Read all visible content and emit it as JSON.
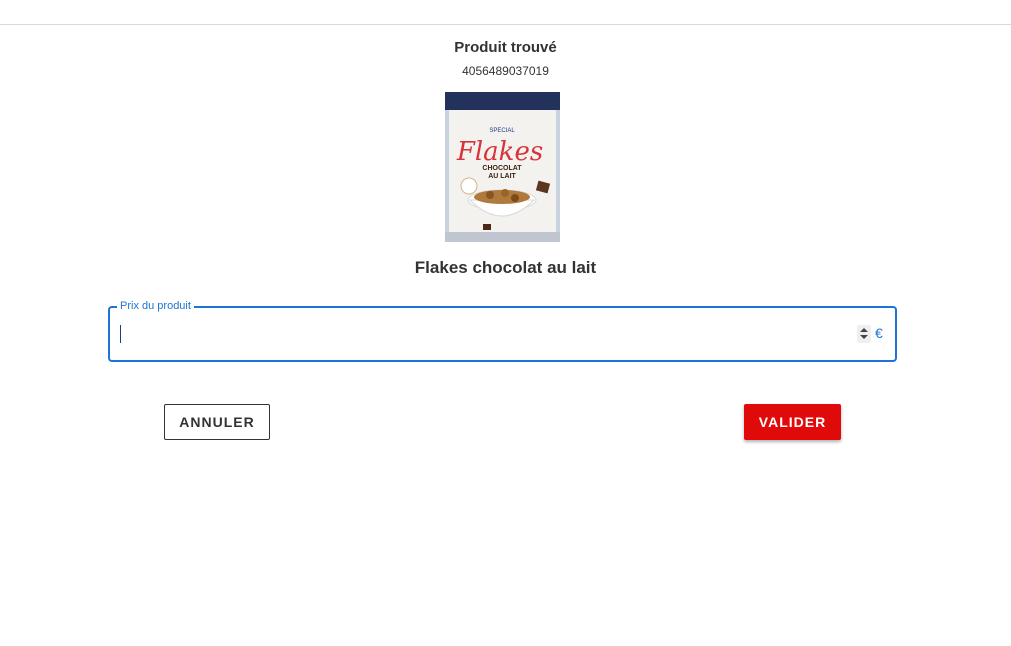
{
  "header": {
    "title": "Produit trouvé"
  },
  "product": {
    "barcode": "4056489037019",
    "name": "Flakes chocolat au lait",
    "image_text": {
      "brand": "SPECIAL",
      "name": "Flakes",
      "subtitle_1": "CHOCOLAT",
      "subtitle_2": "AU LAIT"
    }
  },
  "price_field": {
    "label": "Prix du produit",
    "value": "",
    "currency": "€"
  },
  "actions": {
    "cancel_label": "ANNULER",
    "submit_label": "VALIDER"
  },
  "colors": {
    "accent": "#1e73d6",
    "submit": "#e10a0a"
  }
}
